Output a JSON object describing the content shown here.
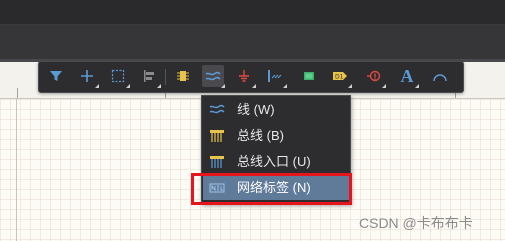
{
  "toolbar": {
    "items": [
      {
        "icon": "filter-icon"
      },
      {
        "icon": "crosshair-plus-icon"
      },
      {
        "icon": "select-rect-icon"
      },
      {
        "icon": "align-icon"
      },
      {
        "icon": "component-icon"
      },
      {
        "icon": "wire-icon"
      },
      {
        "icon": "ground-icon"
      },
      {
        "icon": "bus-entry-icon"
      },
      {
        "icon": "chip-icon"
      },
      {
        "icon": "port-icon"
      },
      {
        "icon": "power-port-icon"
      },
      {
        "icon": "text-icon",
        "text": "A"
      },
      {
        "icon": "arc-icon"
      }
    ],
    "active_index": 5
  },
  "dropdown": {
    "items": [
      {
        "label": "线 (W)",
        "icon": "wire-icon"
      },
      {
        "label": "总线 (B)",
        "icon": "bus-icon"
      },
      {
        "label": "总线入口 (U)",
        "icon": "bus-entry-icon"
      },
      {
        "label": "网络标签 (N)",
        "icon": "net-label-icon"
      }
    ],
    "selected_index": 3
  },
  "colors": {
    "highlight_box": "#e8141c",
    "selected_bg": "#607a9a",
    "icon_blue": "#5b9bd5",
    "icon_yellow": "#e8c44a",
    "icon_red": "#e04a3f"
  },
  "watermark": "CSDN @卡布布卡"
}
